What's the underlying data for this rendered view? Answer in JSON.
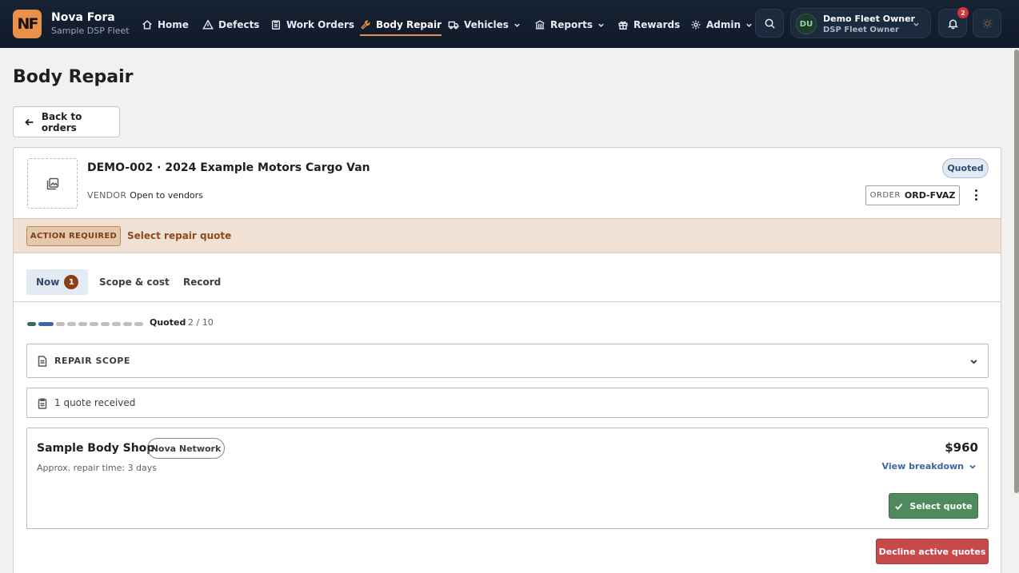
{
  "brand": {
    "logo": "NF",
    "name": "Nova Fora",
    "fleet": "Sample DSP Fleet"
  },
  "nav": {
    "home": "Home",
    "defects": "Defects",
    "work_orders": "Work Orders",
    "body_repair": "Body Repair",
    "vehicles": "Vehicles",
    "reports": "Reports",
    "rewards": "Rewards",
    "admin": "Admin"
  },
  "user": {
    "initials": "DU",
    "name": "Demo Fleet Owner",
    "role": "DSP Fleet Owner"
  },
  "notifications": {
    "count": "2"
  },
  "page": {
    "title": "Body Repair",
    "back_label": "Back to orders"
  },
  "order": {
    "title": "DEMO-002 · 2024 Example Motors Cargo Van",
    "vendor_label": "VENDOR",
    "vendor_value": "Open to vendors",
    "status": "Quoted",
    "order_label": "ORDER",
    "order_id": "ORD-FVAZ"
  },
  "action": {
    "tag": "ACTION REQUIRED",
    "text": "Select repair quote"
  },
  "tabs": {
    "now": "Now",
    "now_count": "1",
    "scope": "Scope & cost",
    "record": "Record"
  },
  "progress": {
    "label": "Quoted",
    "count": "2 / 10",
    "current_step": 2,
    "total_steps": 10
  },
  "scope": {
    "label": "REPAIR SCOPE"
  },
  "quotes": {
    "received": "1 quote received"
  },
  "quote": {
    "shop": "Sample Body Shop",
    "network": "Nova Network",
    "repair_time": "Approx. repair time: 3 days",
    "price": "$960",
    "breakdown": "View breakdown",
    "select": "Select quote"
  },
  "decline": "Decline active quotes",
  "colors": {
    "nav_bg": "#101a2a",
    "accent": "#e8914d",
    "primary_green": "#4e8a5e",
    "danger": "#c64a4a",
    "link": "#3b66a3"
  }
}
